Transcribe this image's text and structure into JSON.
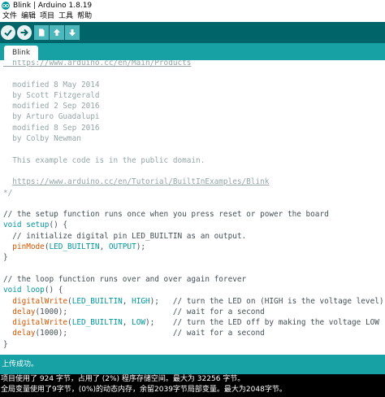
{
  "window": {
    "title": "Blink | Arduino 1.8.19"
  },
  "menu": [
    "文件",
    "编辑",
    "项目",
    "工具",
    "帮助"
  ],
  "toolbar": {
    "buttons": [
      "verify-icon",
      "upload-icon",
      "new-icon",
      "open-icon",
      "save-icon"
    ]
  },
  "tabs": [
    {
      "label": "Blink"
    }
  ],
  "code": {
    "lines": [
      [
        {
          "t": "  https://www.arduino.cc/en/Main/Products",
          "c": "lnk"
        }
      ],
      [],
      [
        {
          "t": "  modified 8 May 2014",
          "c": "cm"
        }
      ],
      [
        {
          "t": "  by Scott Fitzgerald",
          "c": "cm"
        }
      ],
      [
        {
          "t": "  modified 2 Sep 2016",
          "c": "cm"
        }
      ],
      [
        {
          "t": "  by Arturo Guadalupi",
          "c": "cm"
        }
      ],
      [
        {
          "t": "  modified 8 Sep 2016",
          "c": "cm"
        }
      ],
      [
        {
          "t": "  by Colby Newman",
          "c": "cm"
        }
      ],
      [],
      [
        {
          "t": "  This example code is in the public domain.",
          "c": "cm"
        }
      ],
      [],
      [
        {
          "t": "  ",
          "c": "cm"
        },
        {
          "t": "https://www.arduino.cc/en/Tutorial/BuiltInExamples/Blink",
          "c": "lnk"
        }
      ],
      [
        {
          "t": "*/",
          "c": "cm"
        }
      ],
      [],
      [
        {
          "t": "// the setup function runs once when you press reset or power the board",
          "c": ""
        }
      ],
      [
        {
          "t": "void",
          "c": "kw"
        },
        {
          "t": " ",
          "c": ""
        },
        {
          "t": "setup",
          "c": "kw"
        },
        {
          "t": "() {",
          "c": ""
        }
      ],
      [
        {
          "t": "  // initialize digital pin LED_BUILTIN as an output.",
          "c": ""
        }
      ],
      [
        {
          "t": "  ",
          "c": ""
        },
        {
          "t": "pinMode",
          "c": "fn"
        },
        {
          "t": "(",
          "c": ""
        },
        {
          "t": "LED_BUILTIN",
          "c": "cst"
        },
        {
          "t": ", ",
          "c": ""
        },
        {
          "t": "OUTPUT",
          "c": "cst"
        },
        {
          "t": ");",
          "c": ""
        }
      ],
      [
        {
          "t": "}",
          "c": ""
        }
      ],
      [],
      [
        {
          "t": "// the loop function runs over and over again forever",
          "c": ""
        }
      ],
      [
        {
          "t": "void",
          "c": "kw"
        },
        {
          "t": " ",
          "c": ""
        },
        {
          "t": "loop",
          "c": "kw"
        },
        {
          "t": "() {",
          "c": ""
        }
      ],
      [
        {
          "t": "  ",
          "c": ""
        },
        {
          "t": "digitalWrite",
          "c": "fn"
        },
        {
          "t": "(",
          "c": ""
        },
        {
          "t": "LED_BUILTIN",
          "c": "cst"
        },
        {
          "t": ", ",
          "c": ""
        },
        {
          "t": "HIGH",
          "c": "cst"
        },
        {
          "t": ");   // turn the LED on (HIGH is the voltage level)",
          "c": ""
        }
      ],
      [
        {
          "t": "  ",
          "c": ""
        },
        {
          "t": "delay",
          "c": "fn"
        },
        {
          "t": "(1000);                       // wait for a second",
          "c": ""
        }
      ],
      [
        {
          "t": "  ",
          "c": ""
        },
        {
          "t": "digitalWrite",
          "c": "fn"
        },
        {
          "t": "(",
          "c": ""
        },
        {
          "t": "LED_BUILTIN",
          "c": "cst"
        },
        {
          "t": ", ",
          "c": ""
        },
        {
          "t": "LOW",
          "c": "cst"
        },
        {
          "t": ");    // turn the LED off by making the voltage LOW",
          "c": ""
        }
      ],
      [
        {
          "t": "  ",
          "c": ""
        },
        {
          "t": "delay",
          "c": "fn"
        },
        {
          "t": "(1000);                       // wait for a second",
          "c": ""
        }
      ],
      [
        {
          "t": "}",
          "c": ""
        }
      ]
    ]
  },
  "status": {
    "message": "上传成功。"
  },
  "console": {
    "lines": [
      "项目使用了 924 字节，占用了 (2%) 程序存储空间。最大为 32256 字节。",
      "全局变量使用了9字节，(0%)的动态内存，余留2039字节局部变量。最大为2048字节。"
    ]
  },
  "colors": {
    "toolbar": "#006468",
    "tabbar": "#17a1a5",
    "status": "#17a1a5",
    "console": "#000000"
  }
}
